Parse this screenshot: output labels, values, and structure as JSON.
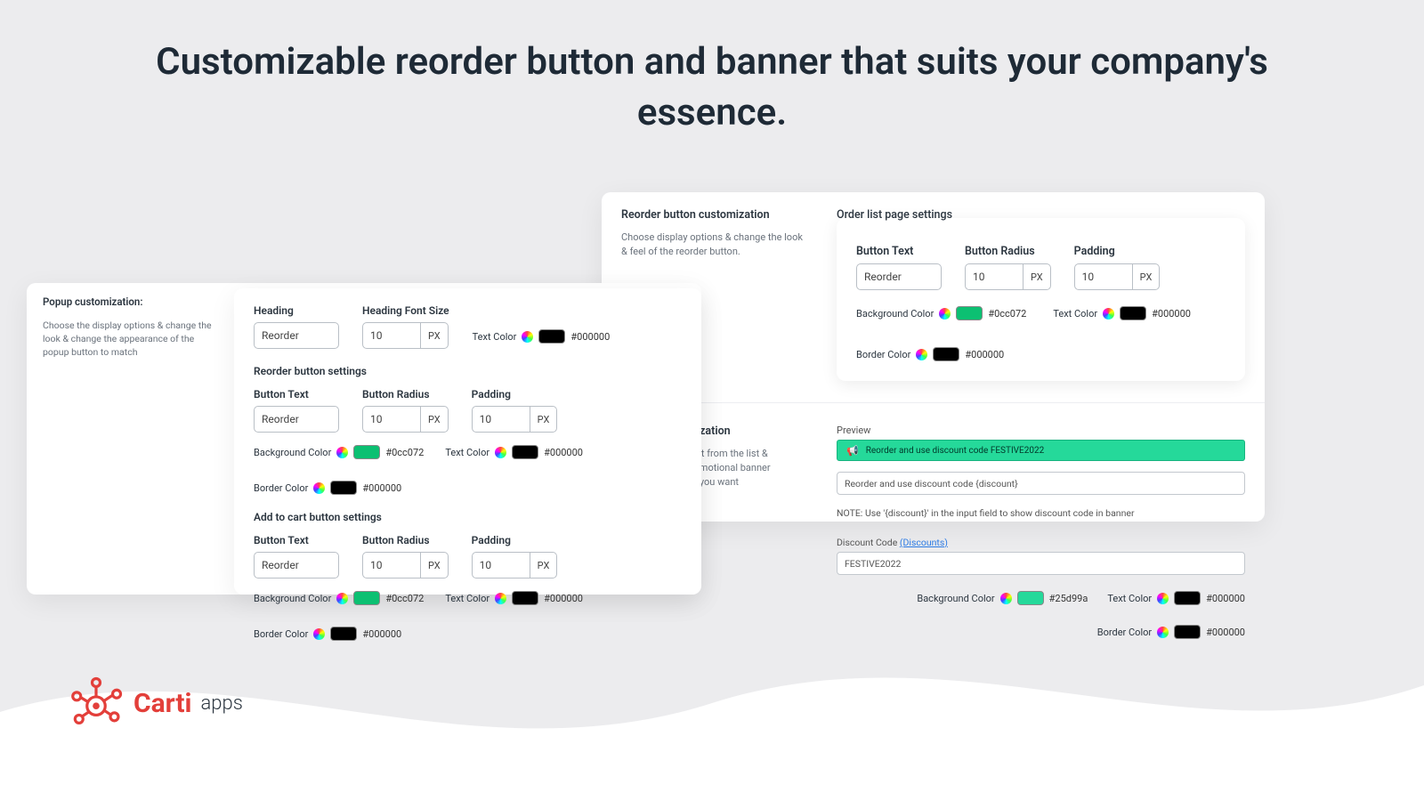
{
  "headline": "Customizable reorder button and banner that suits your company's essence.",
  "brand": {
    "name": "Carti",
    "suffix": "apps"
  },
  "popup_strip": {
    "title": "Popup customization:",
    "desc": "Choose the display options & change the look & change the appearance of the popup button to match"
  },
  "left_card": {
    "heading_label": "Heading",
    "heading_value": "Reorder",
    "font_size_label": "Heading Font Size",
    "font_size_value": "10",
    "font_size_unit": "PX",
    "text_color_label": "Text Color",
    "text_color_hex": "#000000",
    "reorder_section": "Reorder button settings",
    "addcart_section": "Add to cart button settings",
    "button_text_label": "Button Text",
    "button_text_value": "Reorder",
    "button_radius_label": "Button Radius",
    "button_radius_value": "10",
    "padding_label": "Padding",
    "padding_value": "10",
    "unit_px": "PX",
    "bg_label": "Background Color",
    "bg_hex": "#0cc072",
    "tc_label": "Text Color",
    "tc_hex": "#000000",
    "bc_label": "Border Color",
    "bc_hex": "#000000"
  },
  "right_panel": {
    "reorder_side": {
      "title": "Reorder button customization",
      "desc": "Choose display options & change the look & feel of the reorder button."
    },
    "order_card": {
      "title": "Order list page settings",
      "button_text_label": "Button Text",
      "button_text_value": "Reorder",
      "button_radius_label": "Button Radius",
      "button_radius_value": "10",
      "padding_label": "Padding",
      "padding_value": "10",
      "unit_px": "PX",
      "bg_label": "Background Color",
      "bg_hex": "#0cc072",
      "tc_label": "Text Color",
      "tc_hex": "#000000",
      "bc_label": "Border Color",
      "bc_hex": "#000000"
    },
    "banner_side": {
      "title": "Banner customization",
      "desc": "Select the discount from the list & customize the promotional banner message the way you want"
    },
    "banner": {
      "preview_label": "Preview",
      "preview_text": "Reorder and use discount code FESTIVE2022",
      "input_placeholder": "Reorder and use discount code {discount}",
      "note": "NOTE: Use '{discount}' in the input field to show discount code in banner",
      "discount_label": "Discount Code",
      "discount_link": "(Discounts)",
      "discount_value": "FESTIVE2022",
      "bg_label": "Background Color",
      "bg_hex": "#25d99a",
      "tc_label": "Text Color",
      "tc_hex": "#000000",
      "bc_label": "Border Color",
      "bc_hex": "#000000"
    }
  }
}
